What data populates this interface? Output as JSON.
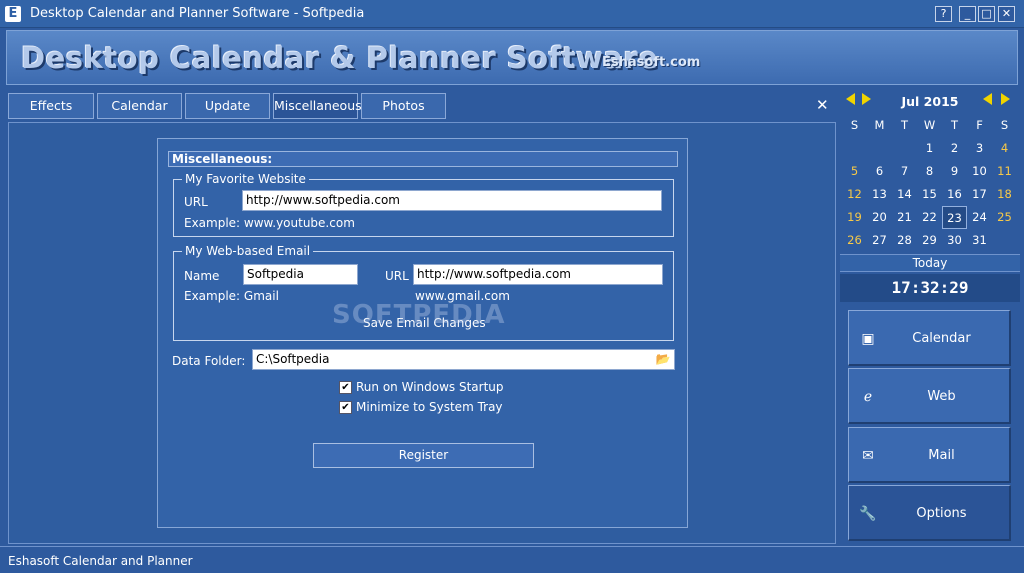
{
  "window": {
    "app_icon": "E",
    "title": "Desktop Calendar and Planner Software - Softpedia",
    "controls": [
      "?",
      "_",
      "□",
      "✕"
    ]
  },
  "banner": {
    "title": "Desktop Calendar & Planner Software",
    "subtitle": "Eshasoft.com"
  },
  "tabs": [
    {
      "label": "Effects"
    },
    {
      "label": "Calendar"
    },
    {
      "label": "Update"
    },
    {
      "label": "Miscellaneous"
    },
    {
      "label": "Photos"
    }
  ],
  "close_label": "✕",
  "misc": {
    "header": "Miscellaneous:",
    "website": {
      "group_title": "My Favorite Website",
      "url_label": "URL",
      "url_value": "http://www.softpedia.com",
      "example": "Example: www.youtube.com"
    },
    "email": {
      "group_title": "My Web-based Email",
      "name_label": "Name",
      "name_value": "Softpedia",
      "url_label": "URL",
      "url_value": "http://www.softpedia.com",
      "name_example": "Example: Gmail",
      "url_example": "www.gmail.com",
      "save_label": "Save Email Changes"
    },
    "data_folder": {
      "label": "Data Folder:",
      "value": "C:\\Softpedia"
    },
    "checkboxes": [
      {
        "label": "Run on Windows Startup",
        "checked": true
      },
      {
        "label": "Minimize to System Tray",
        "checked": true
      }
    ],
    "register_label": "Register"
  },
  "watermark": "SOFTPEDIA",
  "status": {
    "text": "Eshasoft Calendar and Planner"
  },
  "calendar": {
    "month": "Jul 2015",
    "weekdays": [
      "S",
      "M",
      "T",
      "W",
      "T",
      "F",
      "S"
    ],
    "first_weekday_index": 3,
    "days_in_month": 31,
    "today": 23,
    "today_label": "Today",
    "time": "17:32:29"
  },
  "nav": [
    {
      "label": "Calendar",
      "icon": "calendar-card-icon",
      "glyph": "▣"
    },
    {
      "label": "Web",
      "icon": "internet-explorer-icon",
      "glyph": "ℯ"
    },
    {
      "label": "Mail",
      "icon": "mail-bird-icon",
      "glyph": "✉"
    },
    {
      "label": "Options",
      "icon": "wrench-icon",
      "glyph": "🔧"
    }
  ],
  "colors": {
    "background": "#2e5a9e",
    "weekend": "#f7c948",
    "arrow": "#f0d400"
  }
}
